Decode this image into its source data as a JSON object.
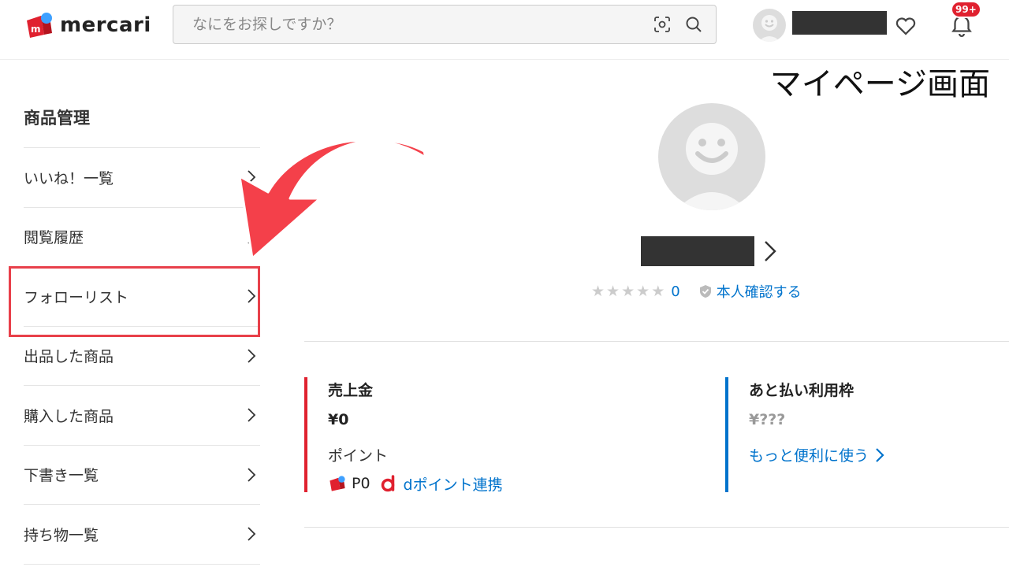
{
  "header": {
    "logo_text": "mercari",
    "search_placeholder": "なにをお探しですか？",
    "notification_badge": "99+"
  },
  "caption": "マイページ画面",
  "sidebar": {
    "title": "商品管理",
    "items": [
      {
        "label": "いいね！一覧"
      },
      {
        "label": "閲覧履歴"
      },
      {
        "label": "フォローリスト"
      },
      {
        "label": "出品した商品"
      },
      {
        "label": "購入した商品"
      },
      {
        "label": "下書き一覧"
      },
      {
        "label": "持ち物一覧"
      }
    ]
  },
  "profile": {
    "rating_count": "0",
    "verify_label": "本人確認する"
  },
  "sales": {
    "title": "売上金",
    "amount": "¥0",
    "points_label": "ポイント",
    "points_value": "P0",
    "dpoint_link": "dポイント連携"
  },
  "credit": {
    "title": "あと払い利用枠",
    "amount": "¥???",
    "more_link": "もっと便利に使う"
  },
  "colors": {
    "brand_red": "#e0212f",
    "link_blue": "#0073cc",
    "highlight_red": "#e8404a"
  }
}
